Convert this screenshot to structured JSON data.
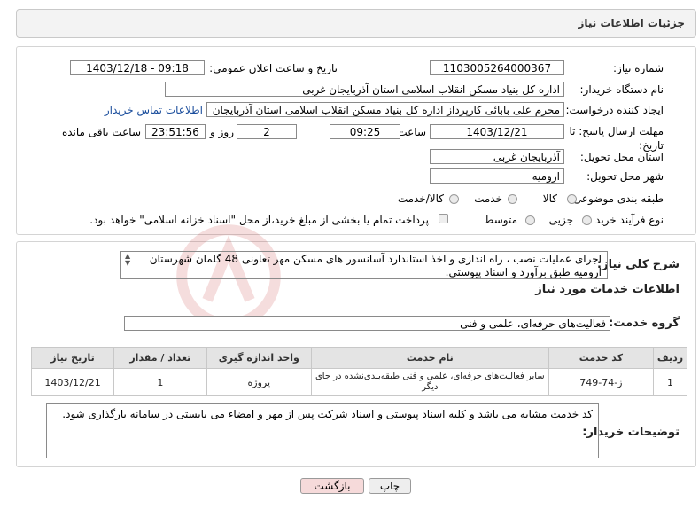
{
  "header": {
    "title": "جزئیات اطلاعات نیاز"
  },
  "fields": {
    "need_number_label": "شماره نیاز:",
    "need_number": "1103005264000367",
    "announce_label": "تاریخ و ساعت اعلان عمومی:",
    "announce_value": "1403/12/18 - 09:18",
    "buyer_org_label": "نام دستگاه خریدار:",
    "buyer_org": "اداره کل بنیاد مسکن انقلاب اسلامی استان آذربایجان غربی",
    "requester_label": "ایجاد کننده درخواست:",
    "requester": "محرم علی بابائی کارپرداز اداره کل بنیاد مسکن انقلاب اسلامی استان آذربایجان",
    "contact_link": "اطلاعات تماس خریدار",
    "deadline_label": "مهلت ارسال پاسخ: تا تاریخ:",
    "deadline_date": "1403/12/21",
    "time_label": "ساعت",
    "deadline_time": "09:25",
    "days_value": "2",
    "days_label": "روز و",
    "remaining_value": "23:51:56",
    "remaining_label": "ساعت باقی مانده",
    "province_label": "استان محل تحویل:",
    "province": "آذربایجان غربی",
    "city_label": "شهر محل تحویل:",
    "city": "ارومیه",
    "category_label": "طبقه بندی موضوعی:",
    "category_options": [
      "کالا",
      "خدمت",
      "کالا/خدمت"
    ],
    "process_label": "نوع فرآیند خرید :",
    "process_options": [
      "جزیی",
      "متوسط"
    ],
    "payment_note": "پرداخت تمام یا بخشی از مبلغ خرید،از محل \"اسناد خزانه اسلامی\" خواهد بود."
  },
  "description": {
    "label": "شرح کلی نیاز:",
    "text": "اجرای عملیات نصب ، راه اندازی و اخذ استاندارد آسانسور های مسکن مهر تعاونی 48 گلمان شهرستان ارومیه طبق برآورد و اسناد پیوستی."
  },
  "services": {
    "section_title": "اطلاعات خدمات مورد نیاز",
    "group_label": "گروه خدمت:",
    "group_value": "فعالیت‌های حرفه‌ای، علمی و فنی",
    "columns": [
      "ردیف",
      "کد خدمت",
      "نام خدمت",
      "واحد اندازه گیری",
      "تعداد / مقدار",
      "تاریخ نیاز"
    ],
    "rows": [
      {
        "row": "1",
        "code": "ز-74-749",
        "name": "سایر فعالیت‌های حرفه‌ای، علمی و فنی طبقه‌بندی‌نشده در جای دیگر",
        "unit": "پروژه",
        "qty": "1",
        "date": "1403/12/21"
      }
    ]
  },
  "notes": {
    "label": "توضیحات خریدار:",
    "text": "کد خدمت مشابه می باشد و کلیه اسناد پیوستی و اسناد شرکت پس از مهر و امضاء می بایستی در سامانه بارگذاری شود."
  },
  "buttons": {
    "print": "چاپ",
    "back": "بازگشت"
  },
  "colors": {
    "back_button_bg": "#f6dada",
    "print_button_bg": "#eeeeee",
    "link": "#1a4d9c"
  }
}
